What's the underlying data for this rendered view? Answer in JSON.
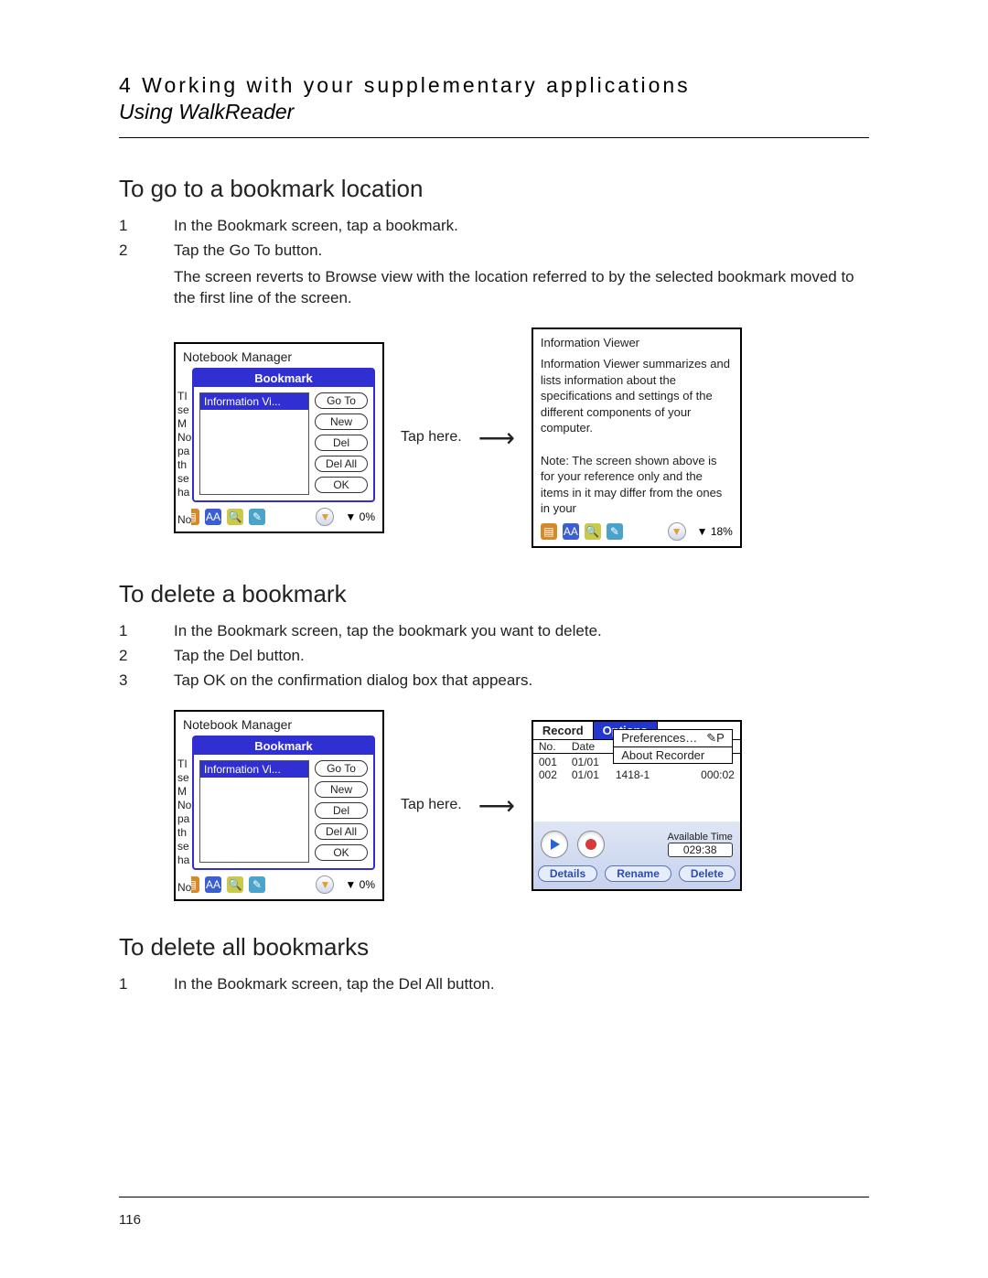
{
  "header": {
    "chapter": "4 Working with your supplementary applications",
    "section": "Using WalkReader"
  },
  "page_number": "116",
  "section1": {
    "title": "To go to a bookmark location",
    "steps": [
      "In the Bookmark screen, tap a bookmark.",
      "Tap the Go To button."
    ],
    "result": "The screen reverts to Browse view with the location referred to by the selected bookmark moved to the first line of the screen.",
    "tap_label": "Tap here."
  },
  "section2": {
    "title": "To delete a bookmark",
    "steps": [
      "In the Bookmark screen, tap the bookmark you want to delete.",
      "Tap the Del button.",
      "Tap OK on the confirmation dialog box that appears."
    ],
    "tap_label": "Tap here."
  },
  "section3": {
    "title": "To delete all bookmarks",
    "steps": [
      "In the Bookmark screen, tap the Del All button."
    ]
  },
  "bookmark_screen": {
    "app_title": "Notebook Manager",
    "dialog_title": "Bookmark",
    "selected_item": "Information Vi...",
    "side_letters": "TI\nse\nM\nNo\npa\nth\nse\nha\n\nNo",
    "buttons": {
      "goto": "Go To",
      "new": "New",
      "del": "Del",
      "delall": "Del All",
      "ok": "OK"
    },
    "toolbar": {
      "aa": "AA",
      "zoom_dropdown": "▼",
      "percent": "0%",
      "nav_arrow": "▼"
    }
  },
  "browse_screen": {
    "title": "Information Viewer",
    "body": "Information Viewer summarizes and lists information about the specifications and settings of the different components of your computer.",
    "note": "Note: The screen shown above is for your reference only and the items in it may differ from the ones in your",
    "percent": "18%"
  },
  "recorder_screen": {
    "menu": {
      "record": "Record",
      "options": "Options"
    },
    "dropdown": {
      "prefs": "Preferences…",
      "shortcut": "✎P",
      "about": "About Recorder"
    },
    "columns": {
      "no": "No.",
      "date": "Date"
    },
    "rows": [
      {
        "no": "001",
        "date": "01/01",
        "name_cut": " ",
        "dur_cut": " "
      },
      {
        "no": "002",
        "date": "01/01",
        "name": "1418-1",
        "dur": "000:02"
      }
    ],
    "available_label": "Available Time",
    "available_value": "029:38",
    "pills": {
      "details": "Details",
      "rename": "Rename",
      "delete": "Delete"
    }
  }
}
